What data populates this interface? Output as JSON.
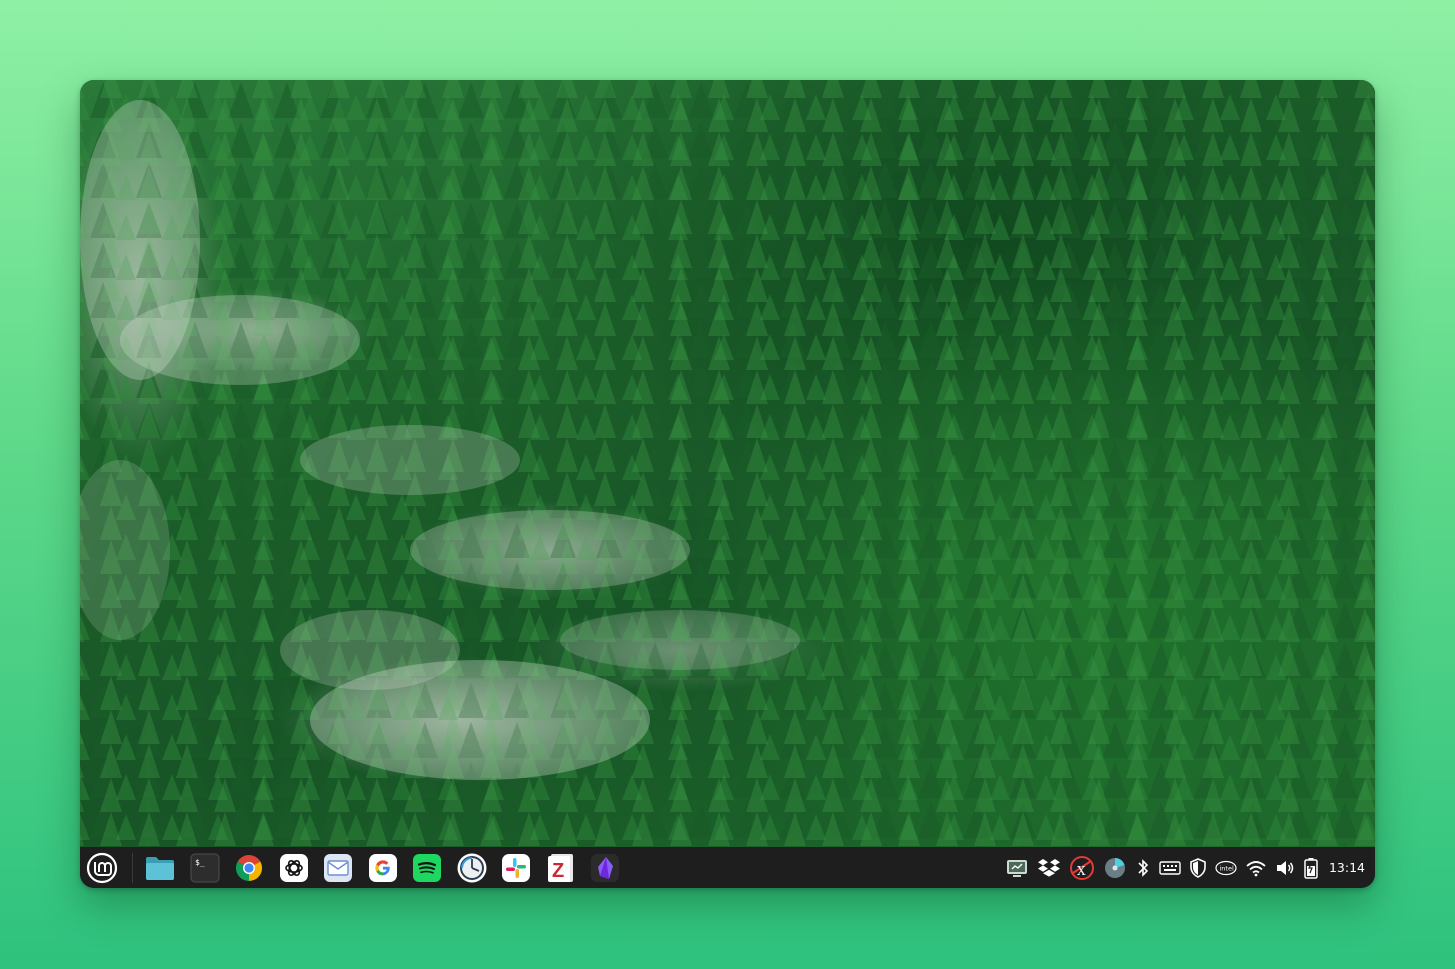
{
  "desktop": {
    "wallpaper": "forest-fog-wallpaper"
  },
  "panel": {
    "menu_icon": "linux-mint-logo-icon",
    "launchers": [
      {
        "name": "files-icon",
        "color": "#4fb7c9"
      },
      {
        "name": "terminal-icon",
        "color": "#2b2b2b"
      },
      {
        "name": "chrome-icon",
        "color": "#db4437"
      },
      {
        "name": "chatgpt-icon",
        "color": "#ffffff"
      },
      {
        "name": "mail-icon",
        "color": "#6b8fd6"
      },
      {
        "name": "google-icon",
        "color": "#ffffff"
      },
      {
        "name": "spotify-icon",
        "color": "#1ed760"
      },
      {
        "name": "timeshift-icon",
        "color": "#ffffff"
      },
      {
        "name": "slack-icon",
        "color": "#ffffff"
      },
      {
        "name": "zotero-icon",
        "color": "#cc2936"
      },
      {
        "name": "obsidian-icon",
        "color": "#7c3aed"
      }
    ],
    "tray": [
      "update-manager-icon",
      "dropbox-icon",
      "xapp-icon",
      "disk-usage-icon",
      "bluetooth-icon",
      "keyboard-icon",
      "shield-icon",
      "intel-icon",
      "wifi-icon",
      "volume-icon",
      "battery-icon"
    ],
    "clock": "13:14"
  }
}
